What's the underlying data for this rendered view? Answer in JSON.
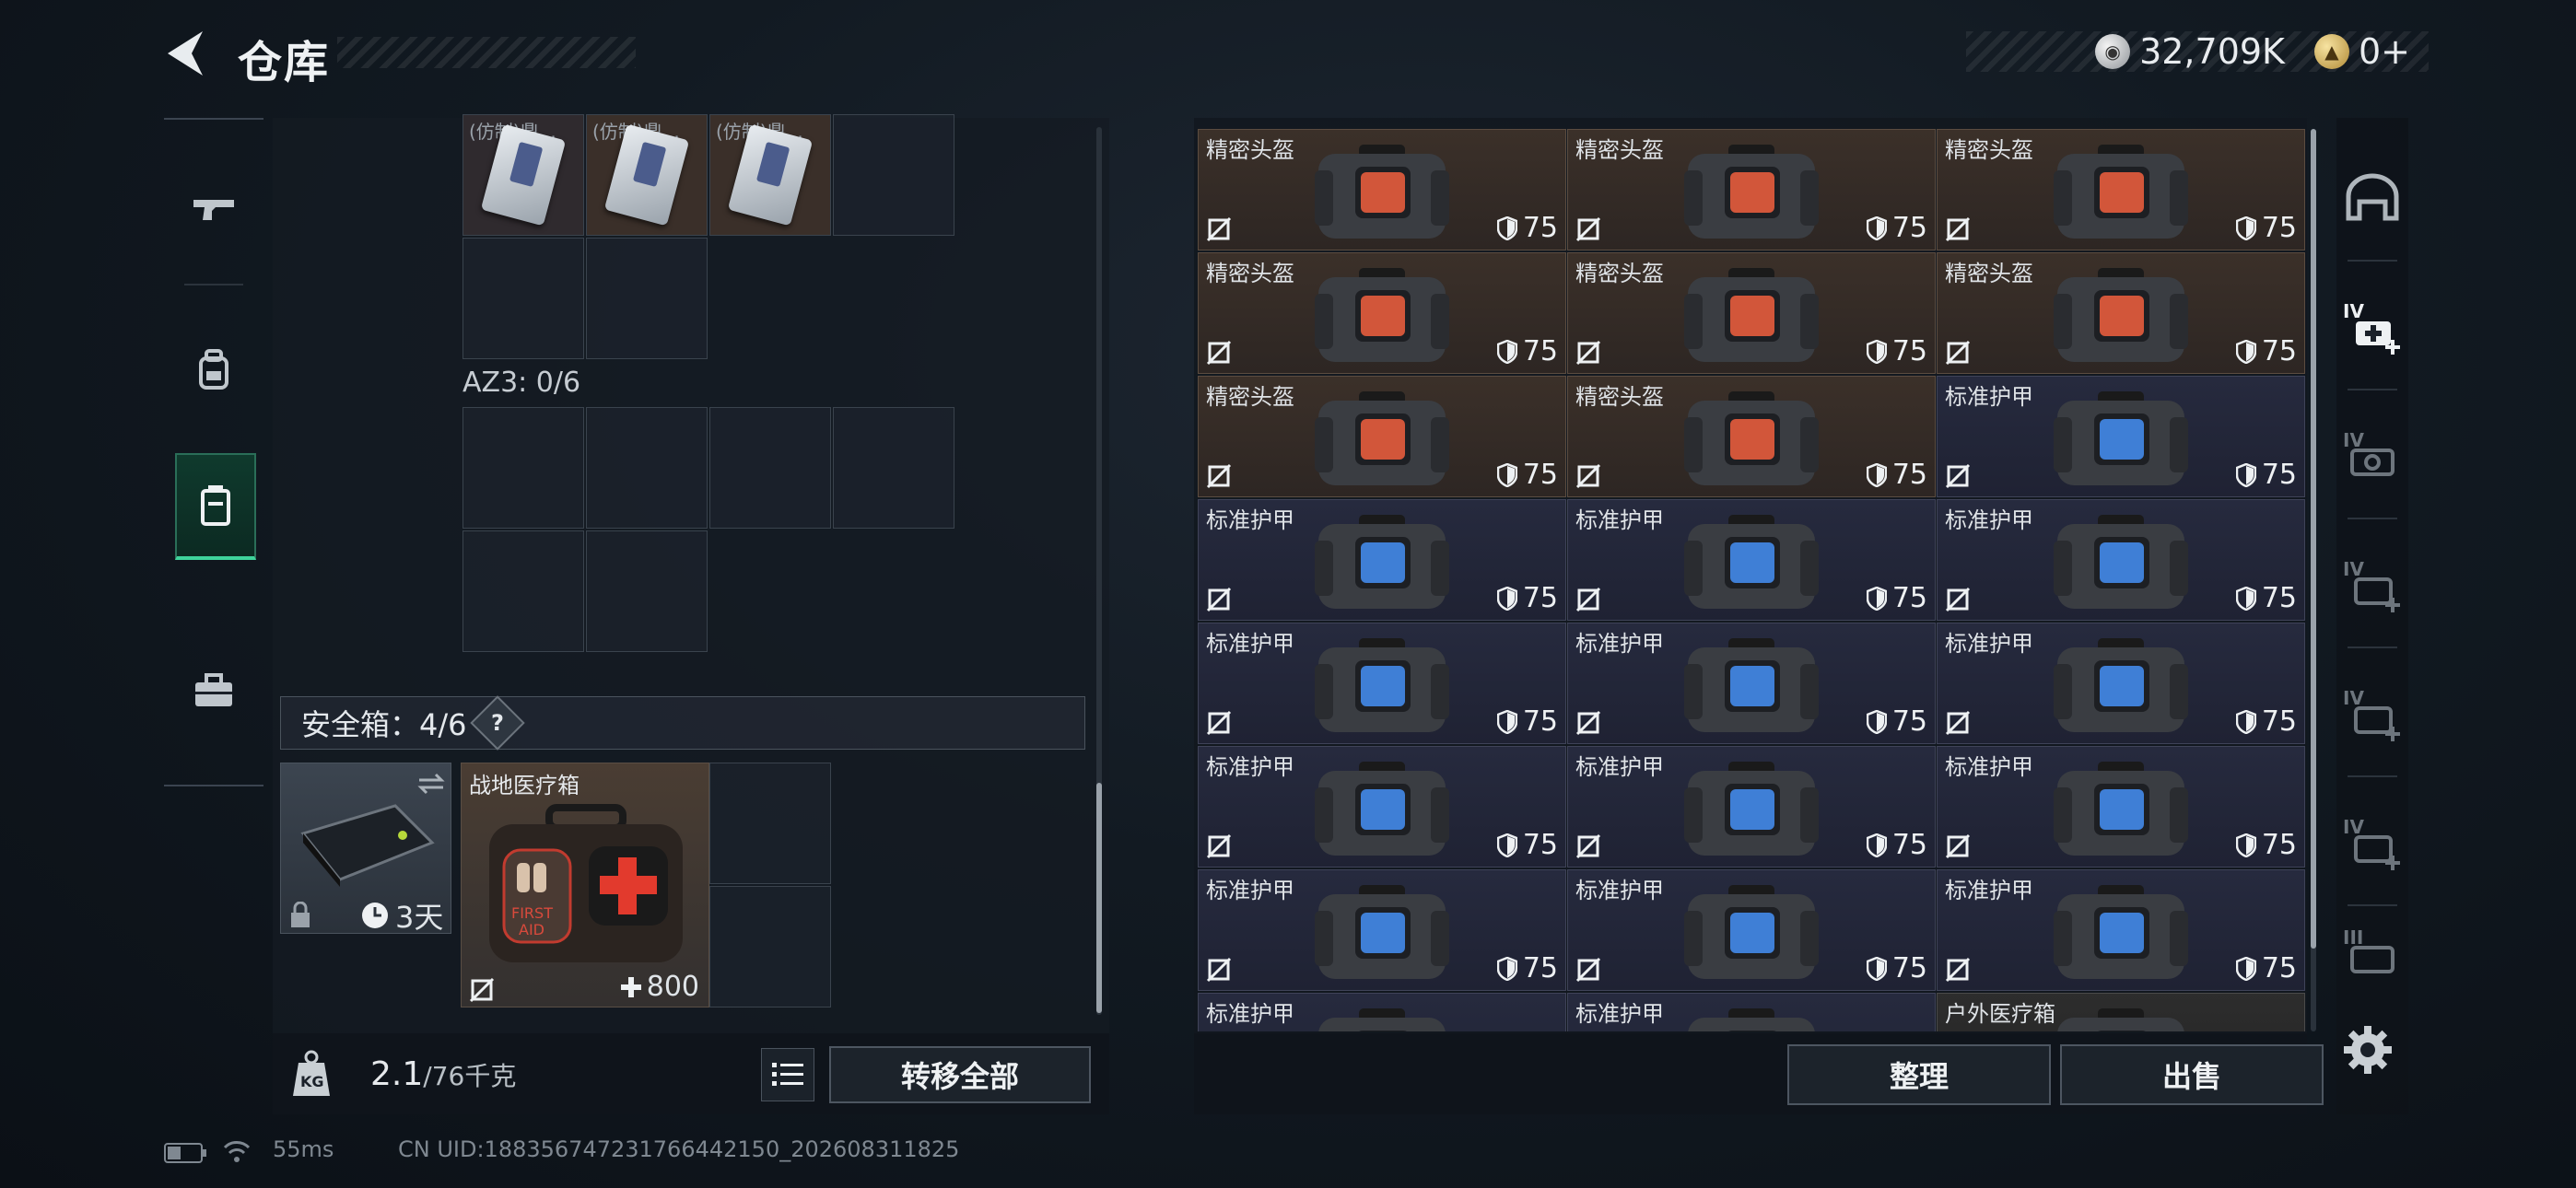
{
  "header": {
    "title": "仓库",
    "silver_amount": "32,709K",
    "gold_amount": "0+"
  },
  "categories": [
    {
      "name": "weapons-icon"
    },
    {
      "name": "backpack-icon"
    },
    {
      "name": "storage-box-icon",
      "active": true
    },
    {
      "name": "toolbox-icon"
    }
  ],
  "storage": {
    "cut_item_label": "(仿制)鼎...",
    "az3_label": "AZ3: 0/6",
    "safe_box_label": "安全箱：4/6",
    "safe_help": "?",
    "safe_box_timer": "3天",
    "med_item": {
      "name": "战地医疗箱",
      "value": "800"
    }
  },
  "bottom_left": {
    "weight": "2.1",
    "weight_max": "/76千克",
    "transfer_all": "转移全部"
  },
  "grid_items": [
    {
      "name": "精密头盔",
      "durability": "75",
      "type": "helmet"
    },
    {
      "name": "精密头盔",
      "durability": "75",
      "type": "helmet"
    },
    {
      "name": "精密头盔",
      "durability": "75",
      "type": "helmet"
    },
    {
      "name": "精密头盔",
      "durability": "75",
      "type": "helmet"
    },
    {
      "name": "精密头盔",
      "durability": "75",
      "type": "helmet"
    },
    {
      "name": "精密头盔",
      "durability": "75",
      "type": "helmet"
    },
    {
      "name": "精密头盔",
      "durability": "75",
      "type": "helmet"
    },
    {
      "name": "精密头盔",
      "durability": "75",
      "type": "helmet"
    },
    {
      "name": "标准护甲",
      "durability": "75",
      "type": "armor"
    },
    {
      "name": "标准护甲",
      "durability": "75",
      "type": "armor"
    },
    {
      "name": "标准护甲",
      "durability": "75",
      "type": "armor"
    },
    {
      "name": "标准护甲",
      "durability": "75",
      "type": "armor"
    },
    {
      "name": "标准护甲",
      "durability": "75",
      "type": "armor"
    },
    {
      "name": "标准护甲",
      "durability": "75",
      "type": "armor"
    },
    {
      "name": "标准护甲",
      "durability": "75",
      "type": "armor"
    },
    {
      "name": "标准护甲",
      "durability": "75",
      "type": "armor"
    },
    {
      "name": "标准护甲",
      "durability": "75",
      "type": "armor"
    },
    {
      "name": "标准护甲",
      "durability": "75",
      "type": "armor"
    },
    {
      "name": "标准护甲",
      "durability": "75",
      "type": "armor"
    },
    {
      "name": "标准护甲",
      "durability": "75",
      "type": "armor"
    },
    {
      "name": "标准护甲",
      "durability": "75",
      "type": "armor"
    },
    {
      "name": "标准护甲",
      "type": "armor"
    },
    {
      "name": "标准护甲",
      "type": "armor"
    },
    {
      "name": "户外医疗箱",
      "type": "medbox"
    }
  ],
  "bottom_right": {
    "sort_label": "整理",
    "sell_label": "出售"
  },
  "filters": [
    {
      "name": "helmet-filter-icon",
      "level": ""
    },
    {
      "name": "medkit-filter-iv-icon",
      "level": "IV"
    },
    {
      "name": "scope-filter-iv-icon",
      "level": "IV"
    },
    {
      "name": "medkit-filter-iv-icon-2",
      "level": "IV"
    },
    {
      "name": "medkit-filter-iv-icon-3",
      "level": "IV"
    },
    {
      "name": "medkit-filter-iv-icon-4",
      "level": "IV"
    },
    {
      "name": "scope-filter-iii-icon",
      "level": "III"
    }
  ],
  "footer": {
    "ping": "55ms",
    "uid": "CN UID:1883567472317664421​50_202608311825"
  },
  "colors": {
    "accent_green": "#3fd39b",
    "helmet_bg": "#3b3029",
    "armor_bg": "#262a3e"
  }
}
